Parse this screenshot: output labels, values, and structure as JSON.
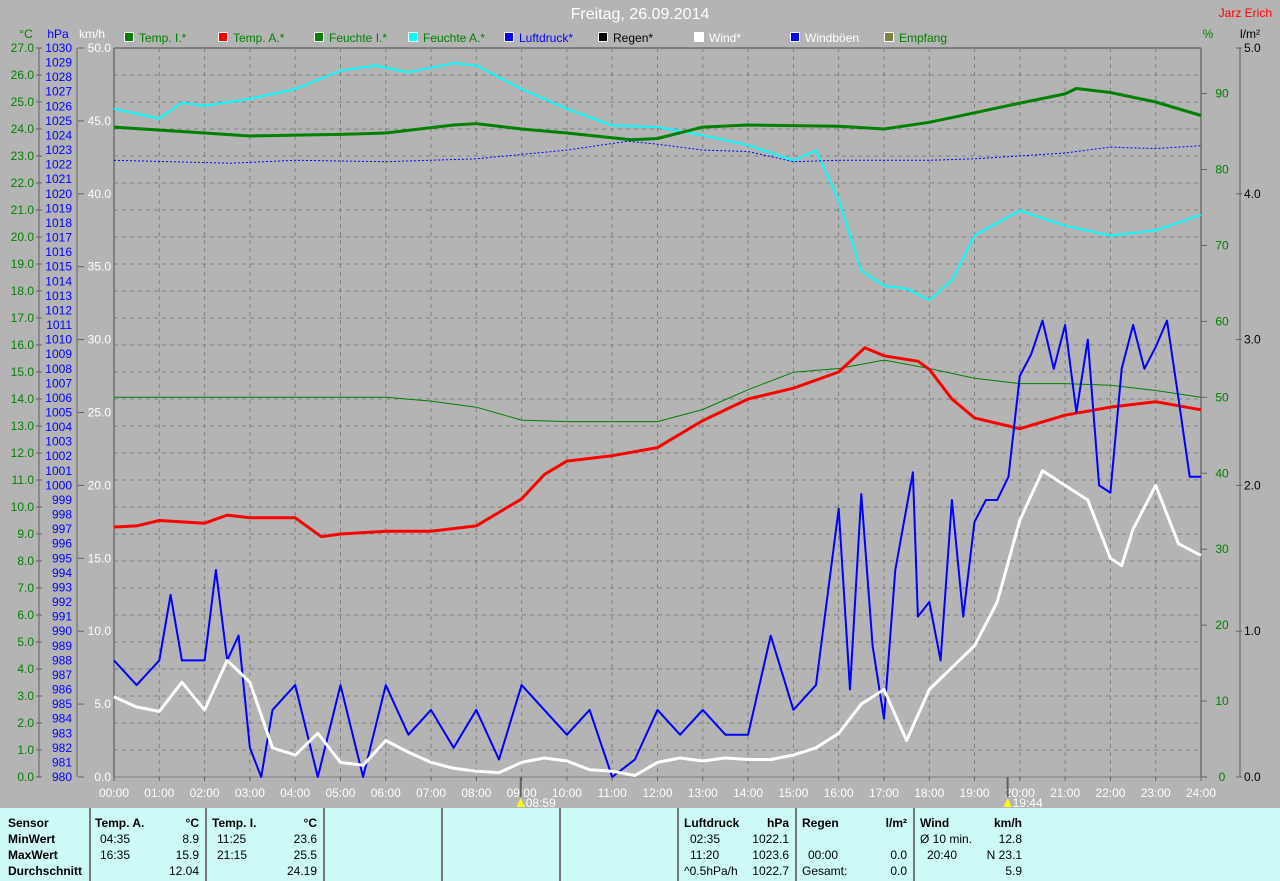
{
  "header": {
    "title": "Freitag, 26.09.2014",
    "author": "Jarz Erich"
  },
  "chart_data": {
    "type": "line",
    "title": "Freitag, 26.09.2014",
    "x_unit": "hours",
    "xlim": [
      0,
      24
    ],
    "x_tick_labels": [
      "00:00",
      "01:00",
      "02:00",
      "03:00",
      "04:00",
      "05:00",
      "06:00",
      "07:00",
      "08:00",
      "09:00",
      "10:00",
      "11:00",
      "12:00",
      "13:00",
      "14:00",
      "15:00",
      "16:00",
      "17:00",
      "18:00",
      "19:00",
      "20:00",
      "21:00",
      "22:00",
      "23:00",
      "24:00"
    ],
    "axes": {
      "temp": {
        "label": "°C",
        "range": [
          0,
          27
        ],
        "step": 1,
        "color": "#008000"
      },
      "pressure": {
        "label": "hPa",
        "range": [
          980,
          1030
        ],
        "step": 1,
        "color": "#0000ff"
      },
      "wind": {
        "label": "km/h",
        "range": [
          0,
          50
        ],
        "step": 5,
        "color": "#ffffff"
      },
      "humidity": {
        "label": "%",
        "range": [
          0,
          96
        ],
        "step": 10,
        "max_tick": 90,
        "color": "#008000"
      },
      "rain": {
        "label": "l/m²",
        "range": [
          0,
          5
        ],
        "step": 1,
        "color": "#000000"
      }
    },
    "legend": [
      {
        "name": "Temp. I.*",
        "color": "#008000",
        "text_color": "#008000"
      },
      {
        "name": "Temp. A.*",
        "color": "#ff0000",
        "text_color": "#008000"
      },
      {
        "name": "Feuchte I.*",
        "color": "#008000",
        "text_color": "#008000"
      },
      {
        "name": "Feuchte A.*",
        "color": "#00ffff",
        "text_color": "#008000"
      },
      {
        "name": "Luftdruck*",
        "color": "#0000ff",
        "text_color": "#0000ff"
      },
      {
        "name": "Regen*",
        "color": "#000000",
        "text_color": "#000000"
      },
      {
        "name": "Wind*",
        "color": "#ffffff",
        "text_color": "#ffffff"
      },
      {
        "name": "Windböen",
        "color": "#0000ff",
        "text_color": "#ffffff"
      },
      {
        "name": "Empfang",
        "color": "#808040",
        "text_color": "#008000"
      }
    ],
    "series": [
      {
        "name": "Feuchte A.*",
        "axis": "humidity",
        "color": "#00ffff",
        "width": 2,
        "x": [
          0,
          1,
          1.5,
          2,
          3,
          4,
          5,
          5.75,
          6.5,
          7.5,
          8,
          9,
          10,
          11,
          12,
          13,
          14,
          15,
          15.5,
          16,
          16.5,
          17,
          17.5,
          18,
          18.5,
          19,
          20,
          21,
          22,
          23,
          24
        ],
        "y": [
          88,
          86.7,
          88.8,
          88.4,
          89.3,
          90.6,
          93,
          93.7,
          92.8,
          94,
          93.7,
          90.6,
          88,
          85.8,
          85.6,
          84.5,
          83.2,
          81.2,
          82.5,
          76,
          66.7,
          64.7,
          64.3,
          62.8,
          65.4,
          71.3,
          74.6,
          72.6,
          71.3,
          72,
          74
        ]
      },
      {
        "name": "Feuchte I.*",
        "axis": "humidity",
        "color": "#008000",
        "width": 1,
        "x": [
          0,
          6,
          7,
          8,
          9,
          10,
          12,
          13,
          14,
          15,
          16,
          17,
          18,
          19,
          20,
          21,
          22,
          23,
          24
        ],
        "y": [
          50,
          50,
          49.5,
          48.7,
          47,
          46.8,
          46.8,
          48.4,
          51,
          53.3,
          53.8,
          54.9,
          53.8,
          52.5,
          51.8,
          51.8,
          51.6,
          50.9,
          50
        ]
      },
      {
        "name": "Luftdruck*",
        "axis": "pressure",
        "color": "#0000ff",
        "width": 1,
        "dash": "2,2",
        "x": [
          0,
          2.58,
          4,
          6,
          8,
          10,
          11.33,
          12,
          13,
          14,
          15,
          16,
          18,
          19,
          20,
          21,
          22,
          23,
          24
        ],
        "y": [
          1022.3,
          1022.1,
          1022.3,
          1022.2,
          1022.4,
          1023.0,
          1023.6,
          1023.4,
          1023.0,
          1022.9,
          1022.2,
          1022.3,
          1022.3,
          1022.4,
          1022.6,
          1022.8,
          1023.2,
          1023.1,
          1023.3
        ]
      },
      {
        "name": "Temp. I.*",
        "axis": "temp",
        "color": "#008000",
        "width": 3,
        "x": [
          0,
          2,
          3,
          5,
          6,
          7.5,
          8,
          9,
          10,
          11.42,
          12,
          13,
          14,
          16,
          17,
          18,
          19,
          20,
          21,
          21.25,
          22,
          23,
          24
        ],
        "y": [
          24.07,
          23.85,
          23.74,
          23.8,
          23.85,
          24.15,
          24.2,
          24.0,
          23.85,
          23.6,
          23.65,
          24.07,
          24.15,
          24.1,
          24.0,
          24.25,
          24.6,
          24.96,
          25.3,
          25.5,
          25.35,
          25.0,
          24.5
        ]
      },
      {
        "name": "Temp. A.*",
        "axis": "temp",
        "color": "#ff0000",
        "width": 3,
        "x": [
          0,
          0.5,
          1,
          2,
          2.5,
          3,
          4,
          4.58,
          5,
          6,
          7,
          8,
          9,
          9.5,
          10,
          11,
          12,
          13,
          14,
          15,
          16,
          16.58,
          17,
          17.75,
          18,
          18.5,
          19,
          20,
          21,
          22,
          23,
          24
        ],
        "y": [
          9.26,
          9.3,
          9.5,
          9.4,
          9.7,
          9.6,
          9.6,
          8.9,
          9.0,
          9.1,
          9.1,
          9.3,
          10.3,
          11.2,
          11.7,
          11.9,
          12.2,
          13.2,
          14.0,
          14.4,
          15.0,
          15.9,
          15.6,
          15.4,
          15.1,
          14.0,
          13.3,
          12.9,
          13.4,
          13.7,
          13.9,
          13.6
        ]
      },
      {
        "name": "Windböen",
        "axis": "wind",
        "color": "#0000ff",
        "width": 2,
        "x": [
          0,
          0.5,
          1,
          1.25,
          1.5,
          2,
          2.25,
          2.5,
          2.75,
          3,
          3.25,
          3.5,
          4,
          4.5,
          5,
          5.5,
          6,
          6.5,
          7,
          7.5,
          8,
          8.5,
          9,
          9.5,
          10,
          10.5,
          11,
          11.5,
          12,
          12.5,
          13,
          13.5,
          14,
          14.5,
          15,
          15.5,
          16,
          16.25,
          16.5,
          16.75,
          17,
          17.25,
          17.64,
          17.75,
          18,
          18.25,
          18.5,
          18.75,
          19,
          19.25,
          19.5,
          19.75,
          20,
          20.25,
          20.5,
          20.75,
          21,
          21.25,
          21.5,
          21.75,
          22,
          22.25,
          22.5,
          22.75,
          23,
          23.25,
          23.5,
          23.75,
          24
        ],
        "y": [
          8,
          6.3,
          8,
          12.5,
          8,
          8,
          14.2,
          8,
          9.7,
          2,
          0,
          4.6,
          6.3,
          0,
          6.3,
          0,
          6.3,
          2.9,
          4.6,
          2,
          4.6,
          1.2,
          6.3,
          4.6,
          2.9,
          4.6,
          0,
          1.2,
          4.6,
          2.9,
          4.6,
          2.9,
          2.9,
          9.7,
          4.6,
          6.3,
          18.4,
          6,
          19.4,
          9,
          4,
          14.2,
          20.9,
          11,
          12,
          8,
          19,
          11,
          17.5,
          19,
          19,
          20.6,
          27.5,
          29,
          31.3,
          28,
          31,
          25,
          30,
          20,
          19.5,
          28,
          31,
          28,
          29.5,
          31.3,
          26,
          20.6,
          20.6
        ]
      },
      {
        "name": "Wind*",
        "axis": "wind",
        "color": "#ffffff",
        "width": 3,
        "x": [
          0,
          0.5,
          1,
          1.5,
          2,
          2.5,
          3,
          3.5,
          4,
          4.5,
          5,
          5.5,
          6,
          6.5,
          7,
          7.5,
          8,
          8.5,
          9,
          9.5,
          10,
          10.5,
          11,
          11.5,
          12,
          12.5,
          13,
          13.5,
          14,
          14.5,
          15,
          15.5,
          16,
          16.5,
          17,
          17.5,
          18,
          18.5,
          19,
          19.5,
          20,
          20.5,
          21,
          21.5,
          22,
          22.25,
          22.5,
          23,
          23.5,
          24
        ],
        "y": [
          5.5,
          4.8,
          4.5,
          6.5,
          4.6,
          8,
          6.5,
          2,
          1.5,
          3,
          1,
          0.8,
          2.5,
          1.7,
          1,
          0.6,
          0.4,
          0.3,
          1,
          1.3,
          1.1,
          0.5,
          0.4,
          0.1,
          1,
          1.3,
          1.1,
          1.3,
          1.2,
          1.2,
          1.5,
          2,
          3,
          5,
          6,
          2.5,
          6,
          7.5,
          9,
          12,
          17.6,
          21,
          20,
          19,
          15,
          14.5,
          17,
          20,
          16,
          15.2
        ]
      }
    ],
    "markers": [
      {
        "label": "08:59",
        "x": 8.98,
        "type": "sunrise"
      },
      {
        "label": "19:44",
        "x": 19.73,
        "type": "sunset"
      }
    ]
  },
  "table": {
    "row_labels": [
      "Sensor",
      "MinWert",
      "MaxWert",
      "Durchschnitt"
    ],
    "temp_a": {
      "title": "Temp. A.",
      "unit": "°C",
      "min_time": "04:35",
      "min": "8.9",
      "max_time": "16:35",
      "max": "15.9",
      "avg": "12.04"
    },
    "temp_i": {
      "title": "Temp. I.",
      "unit": "°C",
      "min_time": "11:25",
      "min": "23.6",
      "max_time": "21:15",
      "max": "25.5",
      "avg": "24.19"
    },
    "pressure": {
      "title": "Luftdruck",
      "unit": "hPa",
      "min_time": "02:35",
      "min": "1022.1",
      "max_time": "11:20",
      "max": "1023.6",
      "trend_label": "^0.5hPa/h",
      "avg": "1022.7"
    },
    "rain": {
      "title": "Regen",
      "unit": "l/m²",
      "time": "00:00",
      "value": "0.0",
      "total_label": "Gesamt:",
      "total": "0.0"
    },
    "wind": {
      "title": "Wind",
      "unit": "km/h",
      "avg_label": "Ø 10 min.",
      "avg10": "12.8",
      "max_time": "20:40",
      "max": "N 23.1",
      "avg": "5.9"
    }
  }
}
